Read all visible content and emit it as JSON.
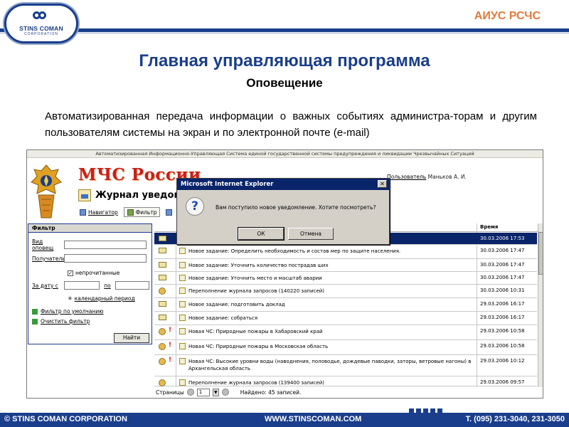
{
  "slide": {
    "logo_text": "STINS COMAN",
    "logo_sub": "CORPORATION",
    "brand": "АИУС РСЧС",
    "title": "Главная управляющая программа",
    "subtitle": "Оповещение",
    "description": "Автоматизированная передача информации о важных событиях администра-торам и другим пользователям системы на экран и по электронной почте (e-mail)"
  },
  "app": {
    "system_title": "Автоматизированная Информационно-Управляющая Система единой государственной системы предупреждения и ликвидации Чрезвычайных Ситуаций",
    "logo_text": "МЧС России",
    "user_label": "Пользователь",
    "user_name": "Маньков А. И.",
    "journal_title": "Журнал уведом",
    "toolbar": {
      "navigator": "Навигатор",
      "filter": "Фильтр"
    },
    "filter_panel": {
      "title": "Фильтр",
      "notification_type_label": "Вид оповещ",
      "notification_type_value": "",
      "recipient_label": "Получатель",
      "recipient_value": "",
      "unread_label": "непрочитанные",
      "unread_checked": true,
      "date_from_label": "За дату с",
      "date_from_value": "",
      "date_to_label": "по",
      "date_to_value": "",
      "calendar_period_label": "календарный период",
      "default_filter_link": "Фильтр по умолчанию",
      "clear_filter_link": "Очистить фильтр",
      "find_button": "Найти"
    },
    "table": {
      "time_header": "Время",
      "rows": [
        {
          "text": "",
          "time": "30.03.2006 17:53",
          "icon": "envelope-icon",
          "important": false,
          "selected": true
        },
        {
          "text": "Новое задание: Определить необходимость и состав мер по защите населения.",
          "time": "30.03.2006 17:47",
          "icon": "envelope-icon",
          "important": false,
          "selected": false
        },
        {
          "text": "Новое задание: Уточнить количество пострадав ших",
          "time": "30.03.2006 17:47",
          "icon": "envelope-icon",
          "important": false,
          "selected": false
        },
        {
          "text": "Новое задание: Уточнить место и масштаб аварии",
          "time": "30.03.2006 17:47",
          "icon": "envelope-icon",
          "important": false,
          "selected": false
        },
        {
          "text": "Переполнение журнала запросов (140220 записей)",
          "time": "30.03.2006 10:31",
          "icon": "alert-envelope-icon",
          "important": false,
          "selected": false
        },
        {
          "text": "Новое задание: подготовить доклад",
          "time": "29.03.2006 16:17",
          "icon": "envelope-icon",
          "important": false,
          "selected": false
        },
        {
          "text": "Новое задание: собраться",
          "time": "29.03.2006 16:17",
          "icon": "envelope-icon",
          "important": false,
          "selected": false
        },
        {
          "text": "Новая ЧС: Природные пожары в Хабаровский край",
          "time": "29.03.2006 10:58",
          "icon": "alert-envelope-icon",
          "important": true,
          "selected": false
        },
        {
          "text": "Новая ЧС: Природные пожары в Московская область",
          "time": "29.03.2006 10:58",
          "icon": "alert-envelope-icon",
          "important": true,
          "selected": false
        },
        {
          "text": "Новая ЧС: Высокие уровни воды (наводнения, половодье, дождевые паводки, заторы, ветровые нагоны) в Архангельская область",
          "time": "29.03.2006 10:12",
          "icon": "alert-envelope-icon",
          "important": true,
          "selected": false
        },
        {
          "text": "Переполнение журнала запросов (139400 записей)",
          "time": "29.03.2006 09:57",
          "icon": "alert-envelope-icon",
          "important": false,
          "selected": false
        }
      ]
    },
    "pager": {
      "pages_label": "Страницы",
      "current_page": "1",
      "found_text": "Найдено: 45 записей."
    }
  },
  "dialog": {
    "title": "Microsoft Internet Explorer",
    "icon": "question-icon",
    "message": "Вам поступило новое уведомление. Хотите посмотреть?",
    "ok_label": "ОК",
    "cancel_label": "Отмена"
  },
  "footer": {
    "company": "© STINS COMAN CORPORATION",
    "website": "WWW.STINSCOMAN.COM",
    "phone": "Т. (095) 231-3040, 231-3050"
  },
  "colors": {
    "brand_blue": "#1a3e8c",
    "brand_orange": "#e07a3a",
    "mchs_red": "#c8201c",
    "selection": "#0a246a"
  }
}
